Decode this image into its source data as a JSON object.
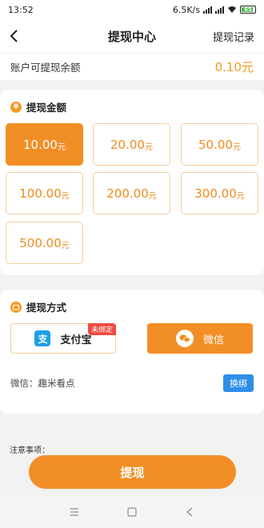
{
  "status": {
    "time": "13:52",
    "speed": "6.5K/s",
    "battery": "65"
  },
  "nav": {
    "title": "提现中心",
    "right": "提现记录"
  },
  "balance": {
    "label": "账户可提现余额",
    "value": "0.10元"
  },
  "amount": {
    "title": "提现金额",
    "icon_glyph": "¥",
    "options": [
      {
        "num": "10.00",
        "unit": "元"
      },
      {
        "num": "20.00",
        "unit": "元"
      },
      {
        "num": "50.00",
        "unit": "元"
      },
      {
        "num": "100.00",
        "unit": "元"
      },
      {
        "num": "200.00",
        "unit": "元"
      },
      {
        "num": "300.00",
        "unit": "元"
      },
      {
        "num": "500.00",
        "unit": "元"
      }
    ],
    "selected_index": 0
  },
  "method": {
    "title": "提现方式",
    "alipay": {
      "label": "支付宝",
      "badge": "未绑定",
      "icon_glyph": "支"
    },
    "wechat": {
      "label": "微信"
    },
    "bind_text": "微信：趣米看点",
    "rebind_label": "换绑"
  },
  "notes_label": "注意事项：",
  "submit_label": "提现",
  "colors": {
    "accent": "#f28e26",
    "blue": "#2f8ee8",
    "badge": "#ef4b3f"
  }
}
